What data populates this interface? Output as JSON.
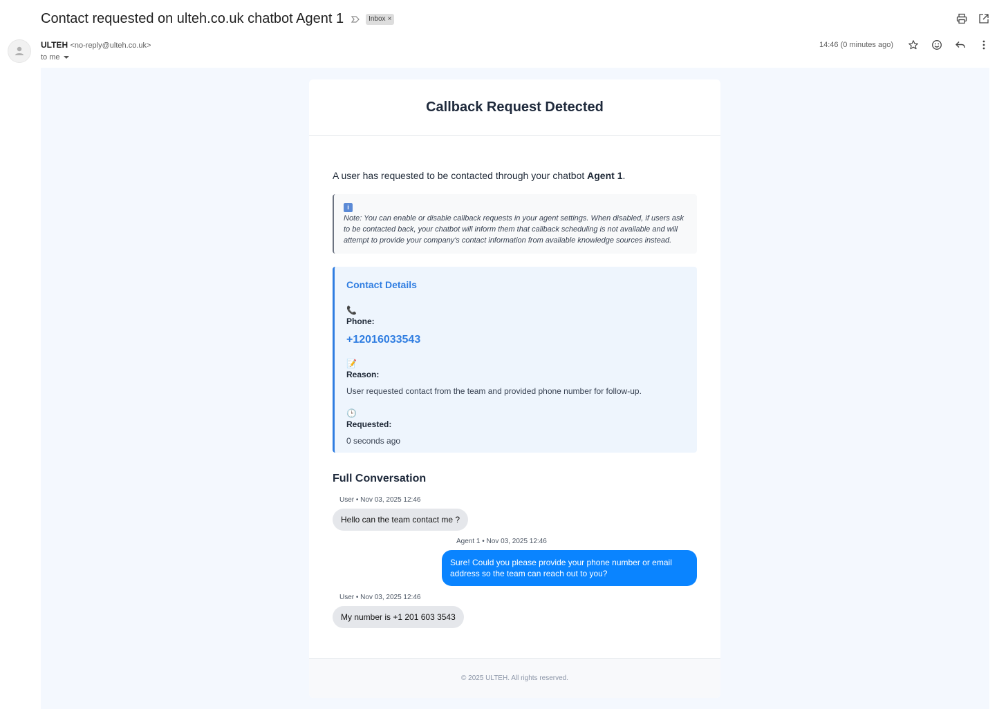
{
  "email": {
    "subject": "Contact requested on ulteh.co.uk chatbot Agent 1",
    "label": "Inbox",
    "label_remove": "×",
    "sender_name": "ULTEH",
    "sender_email": "<no-reply@ulteh.co.uk>",
    "recipient": "to me",
    "time": "14:46 (0 minutes ago)"
  },
  "icons": {
    "print": "printer-icon",
    "open_new": "open-in-new-icon",
    "star": "star-icon",
    "emoji": "emoji-icon",
    "reply": "reply-icon",
    "more": "more-vert-icon",
    "avatar": "person-icon",
    "importance": "importance-marker-icon"
  },
  "message": {
    "title": "Callback Request Detected",
    "intro_prefix": "A user has requested to be contacted through your chatbot ",
    "intro_agent": "Agent 1",
    "intro_suffix": ".",
    "note": "Note: You can enable or disable callback requests in your agent settings. When disabled, if users ask to be contacted back, your chatbot will inform them that callback scheduling is not available and will attempt to provide your company's contact information from available knowledge sources instead.",
    "details": {
      "heading": "Contact Details",
      "phone_label": "Phone:",
      "phone_value": "+12016033543",
      "reason_label": "Reason:",
      "reason_value": "User requested contact from the team and provided phone number for follow-up.",
      "requested_label": "Requested:",
      "requested_value": "0 seconds ago"
    },
    "conversation_title": "Full Conversation",
    "conversation": [
      {
        "meta": "User • Nov 03, 2025 12:46",
        "text": "Hello can the team contact me ?"
      },
      {
        "meta": "Agent 1 • Nov 03, 2025 12:46",
        "text": "Sure! Could you please provide your phone number or email address so the team can reach out to you?"
      },
      {
        "meta": "User • Nov 03, 2025 12:46",
        "text": "My number is +1 201 603 3543"
      }
    ],
    "footer": "© 2025 ULTEH. All rights reserved."
  },
  "colors": {
    "accent": "#2f7de1",
    "agent_bubble": "#0a84ff",
    "user_bubble": "#e5e7eb",
    "body_bg": "#f4f8fe"
  }
}
